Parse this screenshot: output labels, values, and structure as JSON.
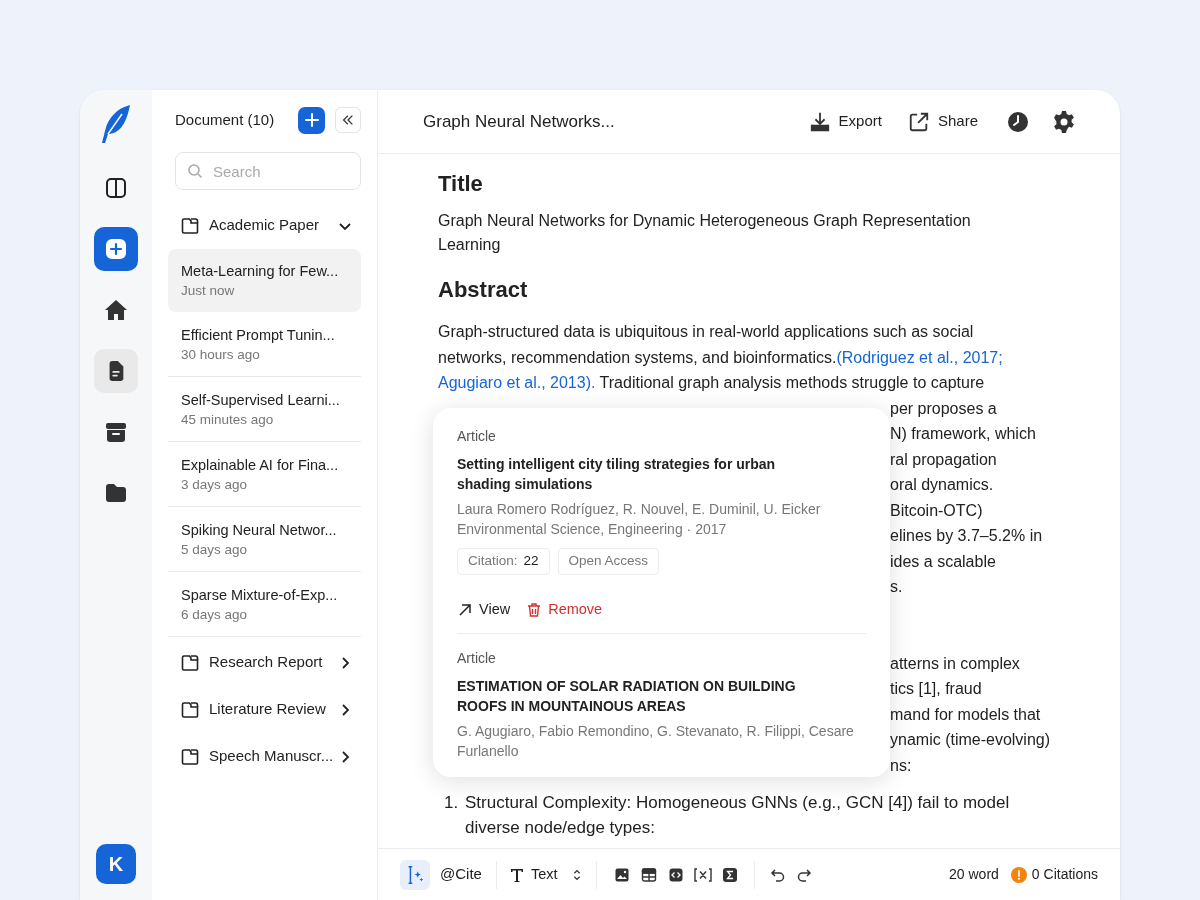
{
  "rail": {
    "items": [
      {
        "kind": "panel",
        "selected": false
      },
      {
        "kind": "new",
        "selected": false
      },
      {
        "kind": "home",
        "selected": false
      },
      {
        "kind": "document",
        "selected": true
      },
      {
        "kind": "archive",
        "selected": false
      },
      {
        "kind": "folder",
        "selected": false
      }
    ],
    "avatar": "K"
  },
  "documents": {
    "title": "Document (10)",
    "search": {
      "placeholder": "Search"
    },
    "folders": [
      {
        "name": "Academic Paper",
        "expanded": true,
        "children": [
          {
            "title": "Meta-Learning for Few...",
            "time": "Just now",
            "selected": true
          },
          {
            "title": "Efficient Prompt Tunin...",
            "time": "30 hours ago",
            "selected": false
          },
          {
            "title": "Self-Supervised Learni...",
            "time": "45 minutes ago",
            "selected": false
          },
          {
            "title": "Explainable AI for Fina...",
            "time": "3 days ago",
            "selected": false
          },
          {
            "title": "Spiking Neural Networ...",
            "time": "5 days ago",
            "selected": false
          },
          {
            "title": "Sparse Mixture-of-Exp...",
            "time": "6 days ago",
            "selected": false
          }
        ]
      },
      {
        "name": "Research Report",
        "expanded": false
      },
      {
        "name": "Literature Review",
        "expanded": false
      },
      {
        "name": "Speech Manuscr...",
        "expanded": false
      }
    ]
  },
  "header": {
    "title": "Graph Neural Networks...",
    "actions": [
      {
        "kind": "export",
        "label": "Export"
      },
      {
        "kind": "share",
        "label": "Share"
      }
    ],
    "icons": [
      {
        "kind": "history"
      },
      {
        "kind": "settings"
      }
    ]
  },
  "editor": {
    "title_heading": "Title",
    "title_text": "Graph Neural Networks for Dynamic Heterogeneous Graph Representation Learning",
    "abstract_heading": "Abstract",
    "abstract_lines": [
      [
        {
          "kind": "text",
          "text": "Graph-structured data is ubiquitous in real-world applications such as social"
        }
      ],
      [
        {
          "kind": "text",
          "text": "networks, recommendation systems, and bioinformatics."
        },
        {
          "kind": "citation",
          "text": "(Rodriguez et al., 2017;"
        }
      ],
      [
        {
          "kind": "citation",
          "text": "Agugiaro et al., 2013)."
        },
        {
          "kind": "text",
          "text": " Traditional graph analysis methods struggle to capture"
        }
      ]
    ],
    "covered_fragments": [
      [
        "per proposes a",
        "N) framework, which",
        "ral propagation",
        "oral dynamics.",
        "Bitcoin-OTC)",
        "elines by 3.7–5.2% in",
        "ides a scalable",
        "s."
      ],
      [
        "atterns in complex",
        "tics [1], fraud",
        "mand for models that",
        "ynamic (time-evolving)",
        "ns:"
      ]
    ],
    "list": [
      {
        "number": "1.",
        "lines": [
          "Structural Complexity: Homogeneous GNNs (e.g., GCN [4]) fail to model",
          "diverse node/edge types:"
        ]
      }
    ]
  },
  "citation_popover": {
    "items": [
      {
        "type": "Article",
        "title": "Setting intelligent city tiling strategies for urban shading simulations",
        "authors": "Laura Romero Rodríguez, R. Nouvel, E. Duminil, U. Eicker",
        "venue": "Environmental Science, Engineering · 2017",
        "citation_label": "Citation:",
        "citation_count": "22",
        "access": "Open Access",
        "actions": [
          {
            "kind": "view",
            "label": "View"
          },
          {
            "kind": "remove",
            "label": "Remove"
          }
        ]
      },
      {
        "type": "Article",
        "title": "ESTIMATION OF SOLAR RADIATION ON BUILDING ROOFS IN MOUNTAINOUS AREAS",
        "authors": "G. Agugiaro, Fabio Remondino, G. Stevanato, R. Filippi, Cesare Furlanello"
      }
    ]
  },
  "toolbar": {
    "cite_assist": {
      "selected": true
    },
    "cite": "@Cite",
    "text_style": "Text",
    "inserts": [
      {
        "kind": "image"
      },
      {
        "kind": "table"
      },
      {
        "kind": "code"
      },
      {
        "kind": "variable"
      },
      {
        "kind": "formula"
      }
    ],
    "history": [
      {
        "kind": "undo"
      },
      {
        "kind": "redo"
      }
    ],
    "word_count": "20 word",
    "citations": "0 Citations"
  }
}
